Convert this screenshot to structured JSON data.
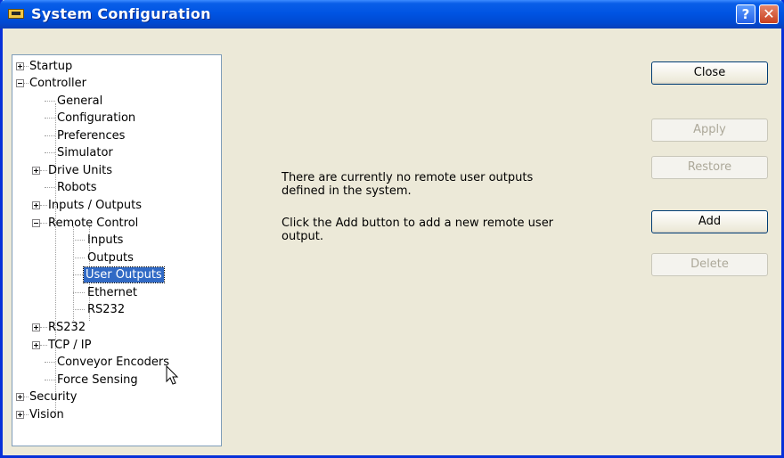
{
  "window": {
    "title": "System Configuration",
    "help_symbol": "?",
    "close_symbol": "✕"
  },
  "tree": {
    "items": [
      {
        "label": "Startup",
        "expanded": false
      },
      {
        "label": "Controller",
        "expanded": true
      },
      {
        "label": "General"
      },
      {
        "label": "Configuration"
      },
      {
        "label": "Preferences"
      },
      {
        "label": "Simulator"
      },
      {
        "label": "Drive Units",
        "expanded": false
      },
      {
        "label": "Robots"
      },
      {
        "label": "Inputs / Outputs",
        "expanded": false
      },
      {
        "label": "Remote Control",
        "expanded": true
      },
      {
        "label": "Inputs"
      },
      {
        "label": "Outputs"
      },
      {
        "label": "User Outputs",
        "selected": true
      },
      {
        "label": "Ethernet"
      },
      {
        "label": "RS232"
      },
      {
        "label": "RS232",
        "expanded": false
      },
      {
        "label": "TCP / IP",
        "expanded": false
      },
      {
        "label": "Conveyor Encoders"
      },
      {
        "label": "Force Sensing"
      },
      {
        "label": "Security",
        "expanded": false
      },
      {
        "label": "Vision",
        "expanded": false
      }
    ]
  },
  "message": {
    "line1": "There are currently no remote user outputs\ndefined  in the system.",
    "line2": "Click the Add button to add a new remote user\noutput."
  },
  "buttons": {
    "close": "Close",
    "apply": "Apply",
    "restore": "Restore",
    "add": "Add",
    "delete": "Delete"
  },
  "colors": {
    "selection": "#316ac5",
    "titlebar": "#0054e3",
    "dialog_bg": "#ece9d8"
  }
}
